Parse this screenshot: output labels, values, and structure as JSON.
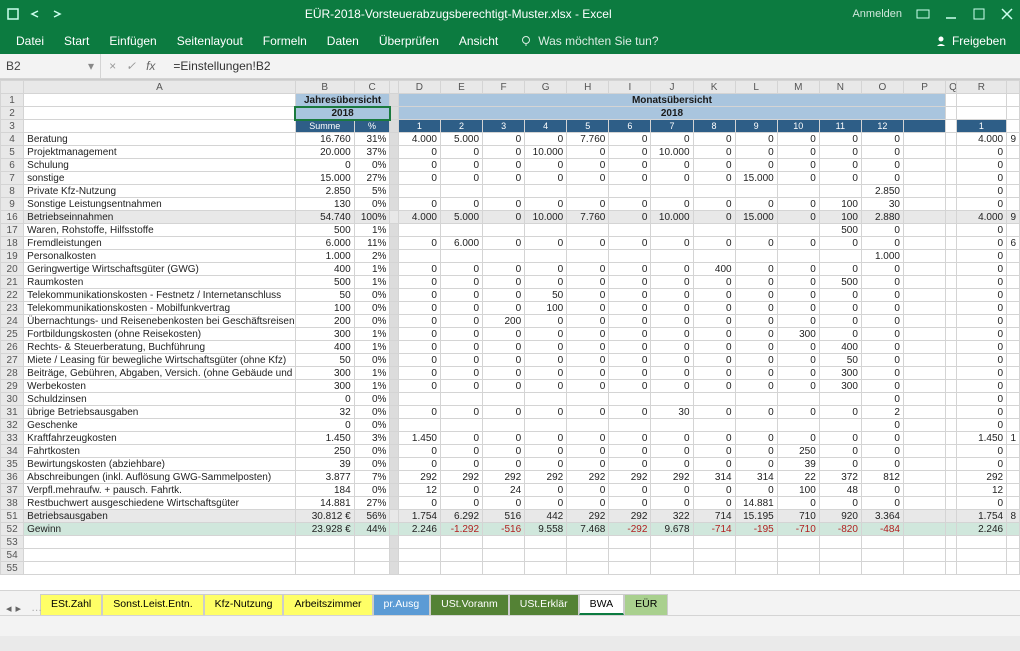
{
  "title": "EÜR-2018-Vorsteuerabzugsberechtigt-Muster.xlsx - Excel",
  "login": "Anmelden",
  "tabs": [
    "Datei",
    "Start",
    "Einfügen",
    "Seitenlayout",
    "Formeln",
    "Daten",
    "Überprüfen",
    "Ansicht"
  ],
  "tellme": "Was möchten Sie tun?",
  "share": "Freigeben",
  "namebox": "B2",
  "formula": "=Einstellungen!B2",
  "colHeaders": [
    "A",
    "B",
    "C",
    "",
    "D",
    "E",
    "F",
    "G",
    "H",
    "I",
    "J",
    "K",
    "L",
    "M",
    "N",
    "O",
    "P",
    "Q",
    "R",
    ""
  ],
  "hdr": {
    "jahres": "Jahresübersicht",
    "monats": "Monatsübersicht",
    "jahr": "2018",
    "summe": "Summe",
    "pct": "%"
  },
  "months": [
    "1",
    "2",
    "3",
    "4",
    "5",
    "6",
    "7",
    "8",
    "9",
    "10",
    "11",
    "12"
  ],
  "rows": [
    {
      "n": 4,
      "l": "Beratung",
      "s": "16.760",
      "p": "31%",
      "m": [
        "4.000",
        "5.000",
        "0",
        "0",
        "7.760",
        "0",
        "0",
        "0",
        "0",
        "0",
        "0",
        "0"
      ],
      "r": "4.000",
      "r2": "9"
    },
    {
      "n": 5,
      "l": "Projektmanagement",
      "s": "20.000",
      "p": "37%",
      "m": [
        "0",
        "0",
        "0",
        "10.000",
        "0",
        "0",
        "10.000",
        "0",
        "0",
        "0",
        "0",
        "0"
      ],
      "r": "0"
    },
    {
      "n": 6,
      "l": "Schulung",
      "s": "0",
      "p": "0%",
      "m": [
        "0",
        "0",
        "0",
        "0",
        "0",
        "0",
        "0",
        "0",
        "0",
        "0",
        "0",
        "0"
      ],
      "r": "0"
    },
    {
      "n": 7,
      "l": "sonstige",
      "s": "15.000",
      "p": "27%",
      "m": [
        "0",
        "0",
        "0",
        "0",
        "0",
        "0",
        "0",
        "0",
        "15.000",
        "0",
        "0",
        "0"
      ],
      "r": "0"
    },
    {
      "n": 8,
      "l": "Private Kfz-Nutzung",
      "s": "2.850",
      "p": "5%",
      "m": [
        "",
        "",
        "",
        "",
        "",
        "",
        "",
        "",
        "",
        "",
        "",
        "2.850"
      ],
      "r": "0"
    },
    {
      "n": 9,
      "l": "Sonstige Leistungsentnahmen",
      "s": "130",
      "p": "0%",
      "m": [
        "0",
        "0",
        "0",
        "0",
        "0",
        "0",
        "0",
        "0",
        "0",
        "0",
        "100",
        "30"
      ],
      "r": "0"
    },
    {
      "n": 16,
      "l": "Betriebseinnahmen",
      "s": "54.740",
      "p": "100%",
      "m": [
        "4.000",
        "5.000",
        "0",
        "10.000",
        "7.760",
        "0",
        "10.000",
        "0",
        "15.000",
        "0",
        "100",
        "2.880"
      ],
      "r": "4.000",
      "r2": "9",
      "sel": true
    },
    {
      "n": 17,
      "l": "Waren, Rohstoffe, Hilfsstoffe",
      "s": "500",
      "p": "1%",
      "m": [
        "",
        "",
        "",
        "",
        "",
        "",
        "",
        "",
        "",
        "",
        "500",
        "0"
      ],
      "r": "0"
    },
    {
      "n": 18,
      "l": "Fremdleistungen",
      "s": "6.000",
      "p": "11%",
      "m": [
        "0",
        "6.000",
        "0",
        "0",
        "0",
        "0",
        "0",
        "0",
        "0",
        "0",
        "0",
        "0"
      ],
      "r": "0",
      "r2": "6"
    },
    {
      "n": 19,
      "l": "Personalkosten",
      "s": "1.000",
      "p": "2%",
      "m": [
        "",
        "",
        "",
        "",
        "",
        "",
        "",
        "",
        "",
        "",
        "",
        "1.000"
      ],
      "r": "0"
    },
    {
      "n": 20,
      "l": "Geringwertige Wirtschaftsgüter (GWG)",
      "s": "400",
      "p": "1%",
      "m": [
        "0",
        "0",
        "0",
        "0",
        "0",
        "0",
        "0",
        "400",
        "0",
        "0",
        "0",
        "0"
      ],
      "r": "0"
    },
    {
      "n": 21,
      "l": "Raumkosten",
      "s": "500",
      "p": "1%",
      "m": [
        "0",
        "0",
        "0",
        "0",
        "0",
        "0",
        "0",
        "0",
        "0",
        "0",
        "500",
        "0"
      ],
      "r": "0"
    },
    {
      "n": 22,
      "l": "Telekommunikationskosten - Festnetz / Internetanschluss",
      "s": "50",
      "p": "0%",
      "m": [
        "0",
        "0",
        "0",
        "50",
        "0",
        "0",
        "0",
        "0",
        "0",
        "0",
        "0",
        "0"
      ],
      "r": "0"
    },
    {
      "n": 23,
      "l": "Telekommunikationskosten - Mobilfunkvertrag",
      "s": "100",
      "p": "0%",
      "m": [
        "0",
        "0",
        "0",
        "100",
        "0",
        "0",
        "0",
        "0",
        "0",
        "0",
        "0",
        "0"
      ],
      "r": "0"
    },
    {
      "n": 24,
      "l": "Übernachtungs- und Reisenebenkosten bei Geschäftsreisen",
      "s": "200",
      "p": "0%",
      "m": [
        "0",
        "0",
        "200",
        "0",
        "0",
        "0",
        "0",
        "0",
        "0",
        "0",
        "0",
        "0"
      ],
      "r": "0"
    },
    {
      "n": 25,
      "l": "Fortbildungskosten (ohne Reisekosten)",
      "s": "300",
      "p": "1%",
      "m": [
        "0",
        "0",
        "0",
        "0",
        "0",
        "0",
        "0",
        "0",
        "0",
        "300",
        "0",
        "0"
      ],
      "r": "0"
    },
    {
      "n": 26,
      "l": "Rechts- & Steuerberatung, Buchführung",
      "s": "400",
      "p": "1%",
      "m": [
        "0",
        "0",
        "0",
        "0",
        "0",
        "0",
        "0",
        "0",
        "0",
        "0",
        "400",
        "0"
      ],
      "r": "0"
    },
    {
      "n": 27,
      "l": "Miete / Leasing für bewegliche Wirtschaftsgüter (ohne Kfz)",
      "s": "50",
      "p": "0%",
      "m": [
        "0",
        "0",
        "0",
        "0",
        "0",
        "0",
        "0",
        "0",
        "0",
        "0",
        "50",
        "0"
      ],
      "r": "0"
    },
    {
      "n": 28,
      "l": "Beiträge, Gebühren, Abgaben, Versich. (ohne Gebäude und Kfz)",
      "s": "300",
      "p": "1%",
      "m": [
        "0",
        "0",
        "0",
        "0",
        "0",
        "0",
        "0",
        "0",
        "0",
        "0",
        "300",
        "0"
      ],
      "r": "0"
    },
    {
      "n": 29,
      "l": "Werbekosten",
      "s": "300",
      "p": "1%",
      "m": [
        "0",
        "0",
        "0",
        "0",
        "0",
        "0",
        "0",
        "0",
        "0",
        "0",
        "300",
        "0"
      ],
      "r": "0"
    },
    {
      "n": 30,
      "l": "Schuldzinsen",
      "s": "0",
      "p": "0%",
      "m": [
        "",
        "",
        "",
        "",
        "",
        "",
        "",
        "",
        "",
        "",
        "",
        "0"
      ],
      "r": "0"
    },
    {
      "n": 31,
      "l": "übrige Betriebsausgaben",
      "s": "32",
      "p": "0%",
      "m": [
        "0",
        "0",
        "0",
        "0",
        "0",
        "0",
        "30",
        "0",
        "0",
        "0",
        "0",
        "2"
      ],
      "r": "0"
    },
    {
      "n": 32,
      "l": "Geschenke",
      "s": "0",
      "p": "0%",
      "m": [
        "",
        "",
        "",
        "",
        "",
        "",
        "",
        "",
        "",
        "",
        "",
        "0"
      ],
      "r": "0"
    },
    {
      "n": 33,
      "l": "Kraftfahrzeugkosten",
      "s": "1.450",
      "p": "3%",
      "m": [
        "1.450",
        "0",
        "0",
        "0",
        "0",
        "0",
        "0",
        "0",
        "0",
        "0",
        "0",
        "0"
      ],
      "r": "1.450",
      "r2": "1"
    },
    {
      "n": 34,
      "l": "Fahrtkosten",
      "s": "250",
      "p": "0%",
      "m": [
        "0",
        "0",
        "0",
        "0",
        "0",
        "0",
        "0",
        "0",
        "0",
        "250",
        "0",
        "0"
      ],
      "r": "0"
    },
    {
      "n": 35,
      "l": "Bewirtungskosten (abziehbare)",
      "s": "39",
      "p": "0%",
      "m": [
        "0",
        "0",
        "0",
        "0",
        "0",
        "0",
        "0",
        "0",
        "0",
        "39",
        "0",
        "0"
      ],
      "r": "0"
    },
    {
      "n": 36,
      "l": "Abschreibungen (inkl. Auflösung GWG-Sammelposten)",
      "s": "3.877",
      "p": "7%",
      "m": [
        "292",
        "292",
        "292",
        "292",
        "292",
        "292",
        "292",
        "314",
        "314",
        "22",
        "372",
        "812"
      ],
      "r": "292"
    },
    {
      "n": 37,
      "l": "Verpfl.mehraufw. + pausch. Fahrtk.",
      "s": "184",
      "p": "0%",
      "m": [
        "12",
        "0",
        "24",
        "0",
        "0",
        "0",
        "0",
        "0",
        "0",
        "100",
        "48",
        "0"
      ],
      "r": "12"
    },
    {
      "n": 38,
      "l": "Restbuchwert ausgeschiedene Wirtschaftsgüter",
      "s": "14.881",
      "p": "27%",
      "m": [
        "0",
        "0",
        "0",
        "0",
        "0",
        "0",
        "0",
        "0",
        "14.881",
        "0",
        "0",
        "0"
      ],
      "r": "0"
    },
    {
      "n": 51,
      "l": "Betriebsausgaben",
      "s": "30.812 €",
      "p": "56%",
      "m": [
        "1.754",
        "6.292",
        "516",
        "442",
        "292",
        "292",
        "322",
        "714",
        "15.195",
        "710",
        "920",
        "3.364"
      ],
      "r": "1.754",
      "r2": "8",
      "sel": true
    },
    {
      "n": 52,
      "l": "Gewinn",
      "s": "23.928 €",
      "p": "44%",
      "m": [
        "2.246",
        "-1.292",
        "-516",
        "9.558",
        "7.468",
        "-292",
        "9.678",
        "-714",
        "-195",
        "-710",
        "-820",
        "-484"
      ],
      "r": "2.246",
      "green": true
    }
  ],
  "blankRows": [
    53,
    54,
    55
  ],
  "sheets": [
    {
      "l": "ESt.Zahl",
      "c": "st-yellow"
    },
    {
      "l": "Sonst.Leist.Entn.",
      "c": "st-yellow"
    },
    {
      "l": "Kfz-Nutzung",
      "c": "st-yellow"
    },
    {
      "l": "Arbeitszimmer",
      "c": "st-yellow"
    },
    {
      "l": "pr.Ausg",
      "c": "st-blue"
    },
    {
      "l": "USt.Voranm",
      "c": "st-dgreen"
    },
    {
      "l": "USt.Erklär",
      "c": "st-dgreen"
    },
    {
      "l": "BWA",
      "c": "st-green",
      "active": true
    },
    {
      "l": "EÜR",
      "c": "st-green"
    }
  ]
}
